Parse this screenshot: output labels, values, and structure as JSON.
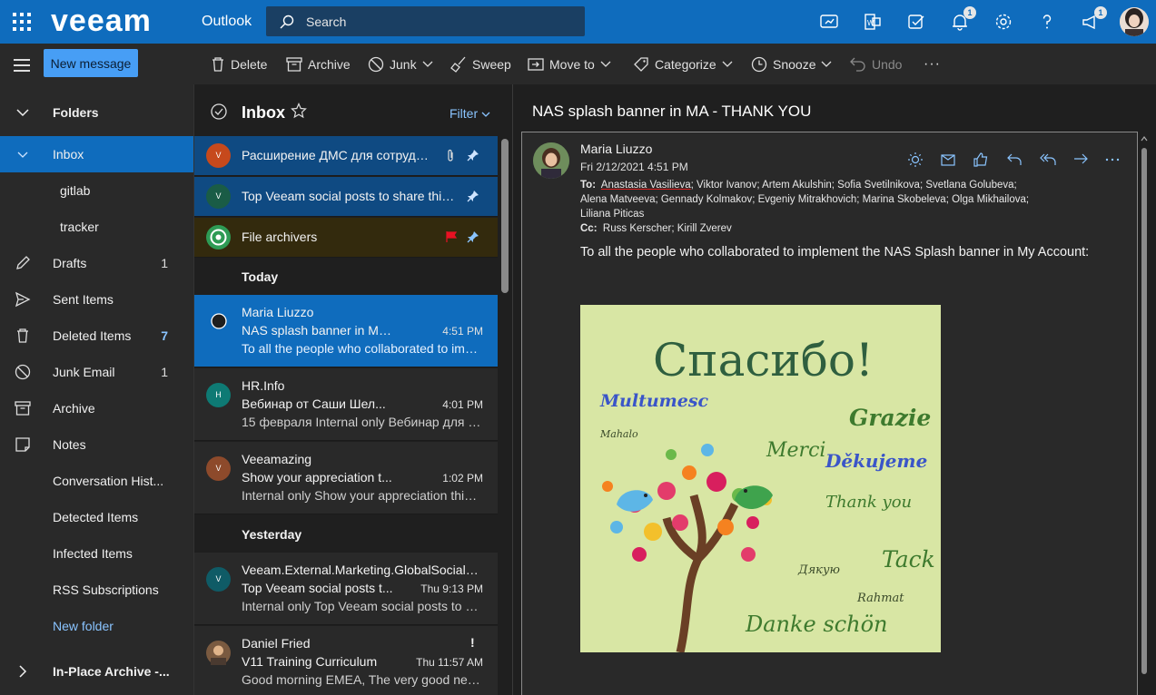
{
  "topbar": {
    "brand": "veeam",
    "app_name": "Outlook",
    "search_placeholder": "Search",
    "notifications_badge": "1",
    "feedback_badge": "1",
    "accent": "#0f6cbd"
  },
  "command_bar": {
    "new_message": "New message",
    "delete": "Delete",
    "archive": "Archive",
    "junk": "Junk",
    "sweep": "Sweep",
    "move_to": "Move to",
    "categorize": "Categorize",
    "snooze": "Snooze",
    "undo": "Undo",
    "more": "···"
  },
  "folders": {
    "header": "Folders",
    "items": [
      {
        "label": "Inbox",
        "count": ""
      },
      {
        "label": "gitlab",
        "count": ""
      },
      {
        "label": "tracker",
        "count": ""
      },
      {
        "label": "Drafts",
        "count": "1"
      },
      {
        "label": "Sent Items",
        "count": ""
      },
      {
        "label": "Deleted Items",
        "count": "7"
      },
      {
        "label": "Junk Email",
        "count": "1"
      },
      {
        "label": "Archive",
        "count": ""
      },
      {
        "label": "Notes",
        "count": ""
      },
      {
        "label": "Conversation Hist...",
        "count": ""
      },
      {
        "label": "Detected Items",
        "count": ""
      },
      {
        "label": "Infected Items",
        "count": ""
      },
      {
        "label": "RSS Subscriptions",
        "count": ""
      }
    ],
    "new_folder": "New folder",
    "archive_group": "In-Place Archive -..."
  },
  "list": {
    "title": "Inbox",
    "filter": "Filter",
    "pinned": [
      {
        "avatar": "V",
        "avatar_color": "#c6491c",
        "subject": "Расширение ДМС для сотрудников"
      },
      {
        "avatar": "V",
        "avatar_color": "#1a5c46",
        "subject": "Top Veeam social posts to share this week"
      },
      {
        "avatar": "",
        "avatar_color": "#2e9b55",
        "subject": "File archivers"
      }
    ],
    "today_label": "Today",
    "yesterday_label": "Yesterday",
    "messages": [
      {
        "avatar": "",
        "sender": "Maria Liuzzo",
        "subject": "NAS splash banner in MA...",
        "time": "4:51 PM",
        "preview": "To all the people who collaborated to implement"
      },
      {
        "avatar": "H",
        "avatar_color": "#0e7a74",
        "sender": "HR.Info",
        "subject": "Вебинар от Саши Шел...",
        "time": "4:01 PM",
        "preview": "15 февраля Internal only Вебинар для сотрудников"
      },
      {
        "avatar": "V",
        "avatar_color": "#8d4a2b",
        "sender": "Veeamazing",
        "subject": "Show your appreciation t...",
        "time": "1:02 PM",
        "preview": "Internal only Show your appreciation this Valentine"
      },
      {
        "avatar": "V",
        "avatar_color": "#0f5b66",
        "sender": "Veeam.External.Marketing.GlobalSocialMedia",
        "subject": "Top Veeam social posts t...",
        "time": "Thu 9:13 PM",
        "preview": "Internal only Top Veeam social posts to share"
      },
      {
        "avatar": "",
        "sender": "Daniel Fried",
        "subject": "V11 Training Curriculum",
        "time": "Thu 11:57 AM",
        "preview": "Good morning EMEA, The very good news",
        "importance": "!"
      }
    ]
  },
  "reading": {
    "subject": "NAS splash banner in MA - THANK YOU",
    "sender": "Maria Liuzzo",
    "date": "Fri 2/12/2021 4:51 PM",
    "to_label": "To:",
    "to_first": "Anastasia Vasilieva",
    "to_rest": "; Viktor Ivanov; Artem Akulshin; Sofia Svetilnikova; Svetlana Golubeva; Alena Matveeva; Gennady Kolmakov; Evgeniy Mitrakhovich; Marina Skobeleva; Olga Mikhailova; Liliana Piticas",
    "cc_label": "Cc:",
    "cc": "Russ Kerscher; Kirill Zverev",
    "body": "To all the people who collaborated to implement the NAS Splash banner in My Account:",
    "image": {
      "title": "Спасибо!",
      "words": [
        "Multumesc",
        "Grazie",
        "Mahalo",
        "Merci",
        "Děkujeme",
        "Thank you",
        "Tack",
        "Дякую",
        "Rahmat",
        "Danke schön"
      ]
    }
  }
}
